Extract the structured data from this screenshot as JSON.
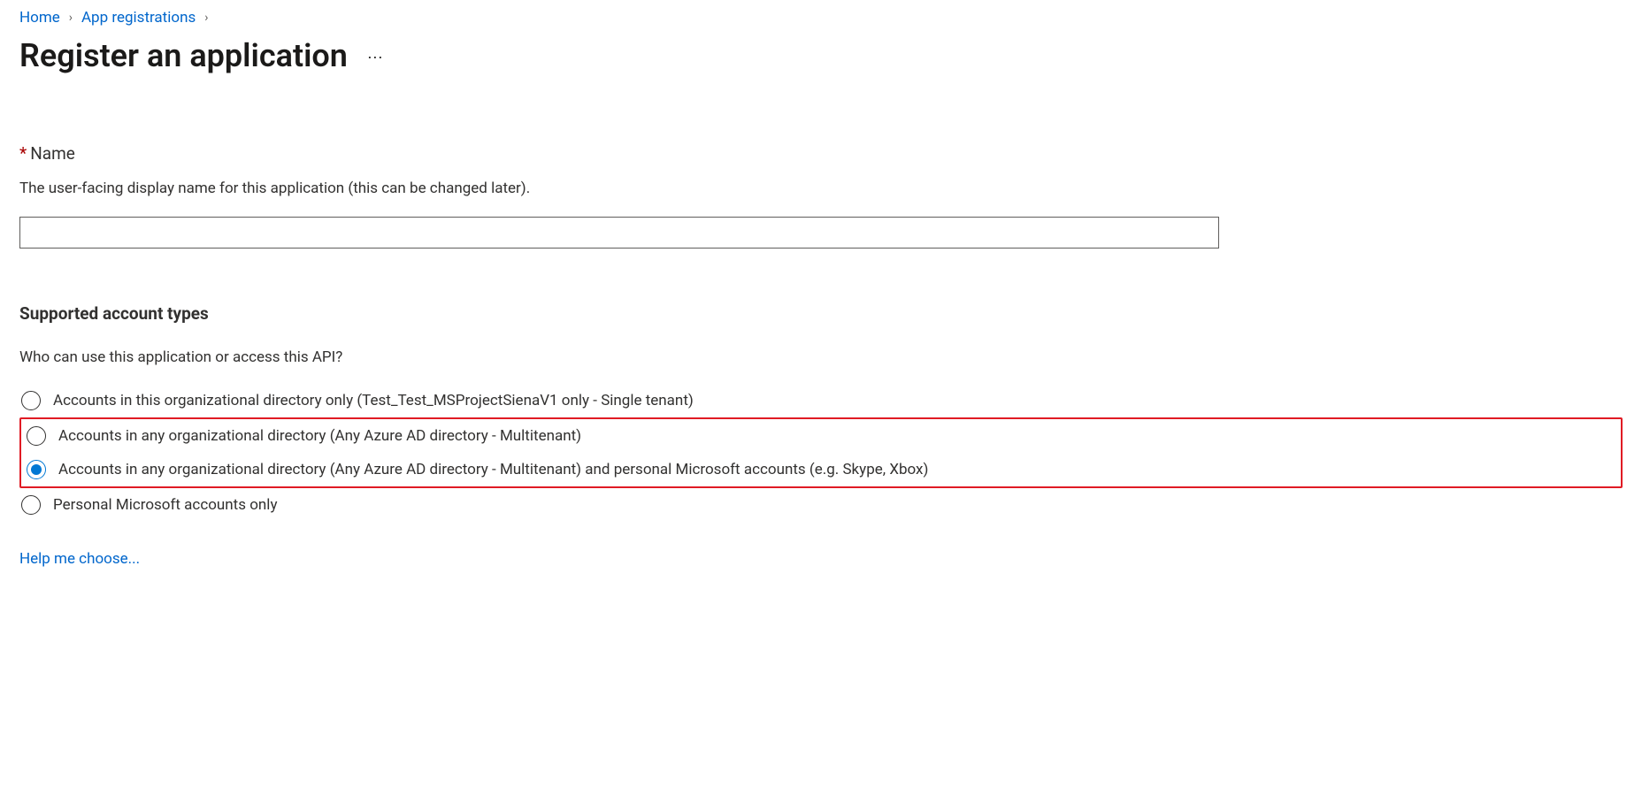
{
  "breadcrumb": {
    "items": [
      {
        "label": "Home"
      },
      {
        "label": "App registrations"
      }
    ]
  },
  "page": {
    "title": "Register an application"
  },
  "nameField": {
    "asterisk": "*",
    "label": "Name",
    "description": "The user-facing display name for this application (this can be changed later).",
    "value": ""
  },
  "accountTypes": {
    "header": "Supported account types",
    "question": "Who can use this application or access this API?",
    "options": [
      {
        "label": "Accounts in this organizational directory only (Test_Test_MSProjectSienaV1 only - Single tenant)",
        "selected": false
      },
      {
        "label": "Accounts in any organizational directory (Any Azure AD directory - Multitenant)",
        "selected": false
      },
      {
        "label": "Accounts in any organizational directory (Any Azure AD directory - Multitenant) and personal Microsoft accounts (e.g. Skype, Xbox)",
        "selected": true
      },
      {
        "label": "Personal Microsoft accounts only",
        "selected": false
      }
    ],
    "helpLink": "Help me choose..."
  }
}
